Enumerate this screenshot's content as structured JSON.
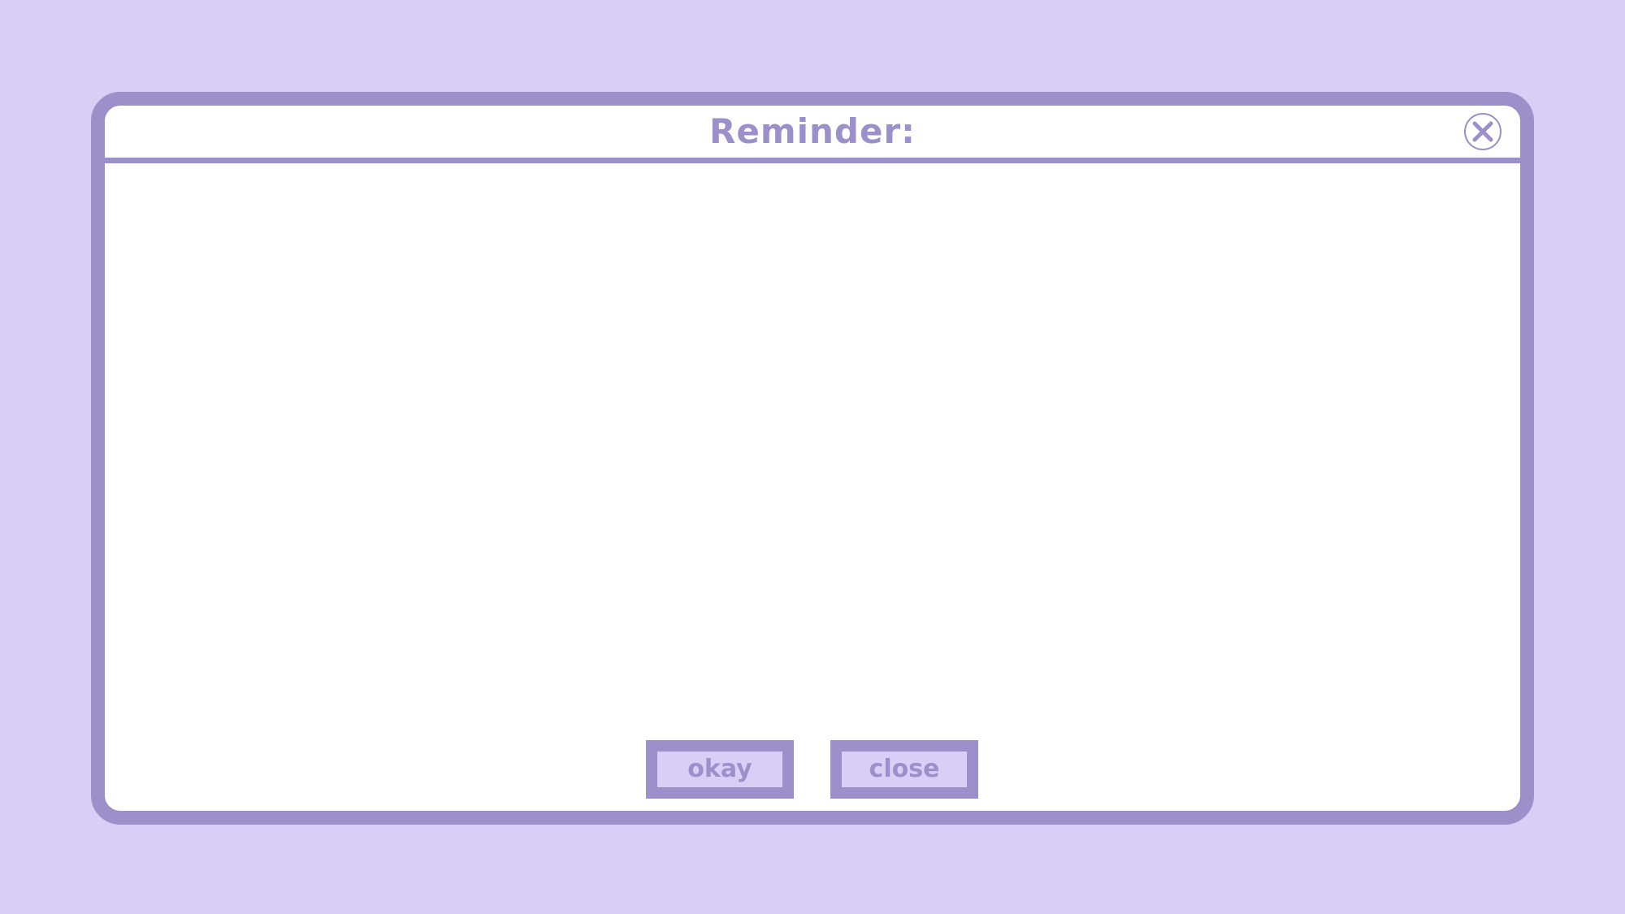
{
  "dialog": {
    "title": "Reminder:",
    "close_icon": "close-circle-x-icon",
    "buttons": {
      "okay_label": "okay",
      "close_label": "close"
    }
  },
  "colors": {
    "background": "#d7cff6",
    "accent": "#9b90ca",
    "panel": "#ffffff"
  }
}
